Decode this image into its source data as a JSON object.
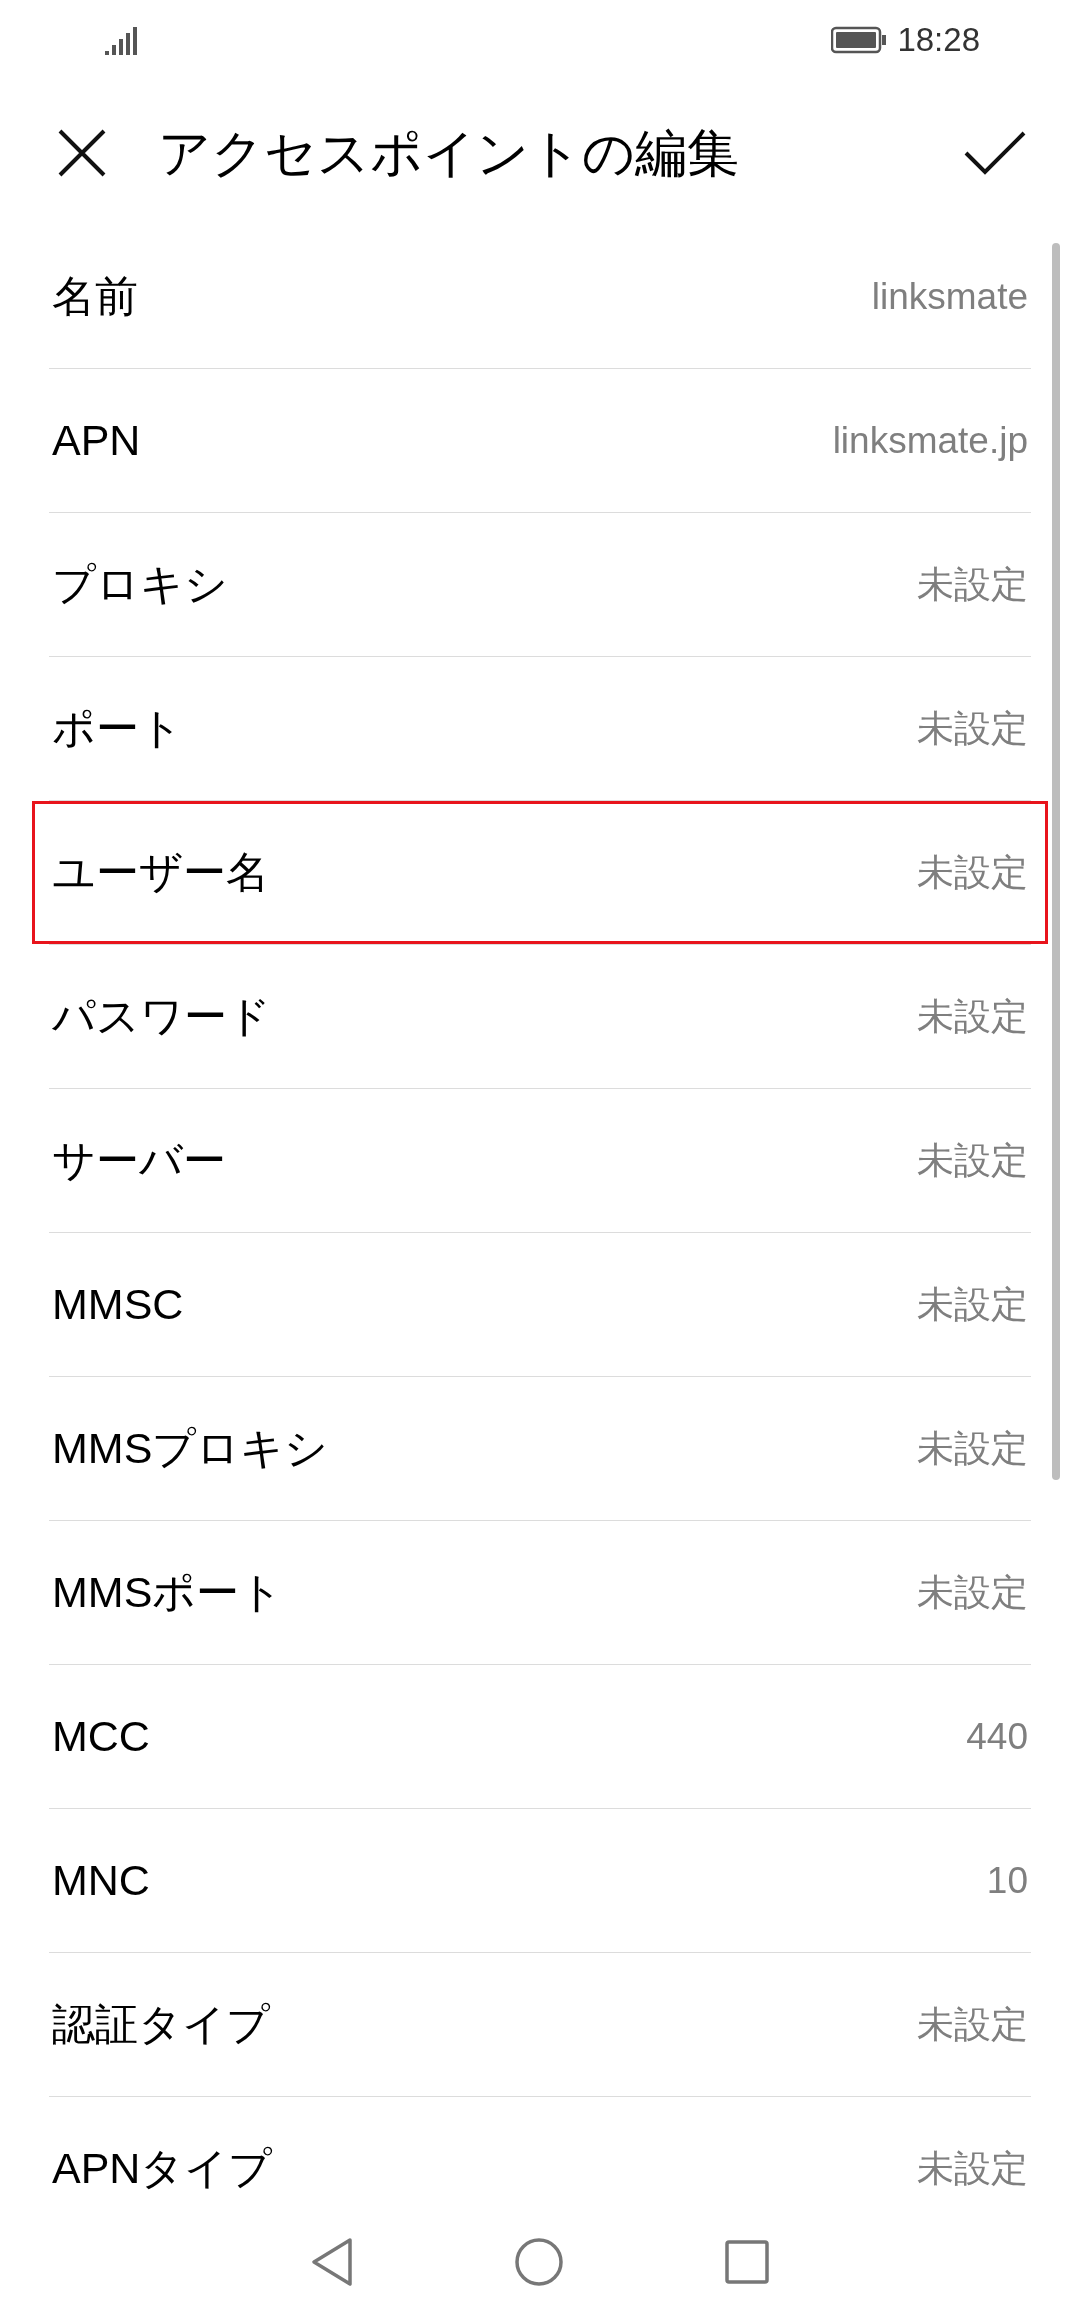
{
  "status_bar": {
    "time": "18:28"
  },
  "header": {
    "title": "アクセスポイントの編集"
  },
  "rows": [
    {
      "label": "名前",
      "value": "linksmate",
      "highlighted": false
    },
    {
      "label": "APN",
      "value": "linksmate.jp",
      "highlighted": false
    },
    {
      "label": "プロキシ",
      "value": "未設定",
      "highlighted": false
    },
    {
      "label": "ポート",
      "value": "未設定",
      "highlighted": false
    },
    {
      "label": "ユーザー名",
      "value": "未設定",
      "highlighted": true
    },
    {
      "label": "パスワード",
      "value": "未設定",
      "highlighted": false
    },
    {
      "label": "サーバー",
      "value": "未設定",
      "highlighted": false
    },
    {
      "label": "MMSC",
      "value": "未設定",
      "highlighted": false
    },
    {
      "label": "MMSプロキシ",
      "value": "未設定",
      "highlighted": false
    },
    {
      "label": "MMSポート",
      "value": "未設定",
      "highlighted": false
    },
    {
      "label": "MCC",
      "value": "440",
      "highlighted": false
    },
    {
      "label": "MNC",
      "value": "10",
      "highlighted": false
    },
    {
      "label": "認証タイプ",
      "value": "未設定",
      "highlighted": false
    },
    {
      "label": "APNタイプ",
      "value": "未設定",
      "highlighted": false
    }
  ]
}
